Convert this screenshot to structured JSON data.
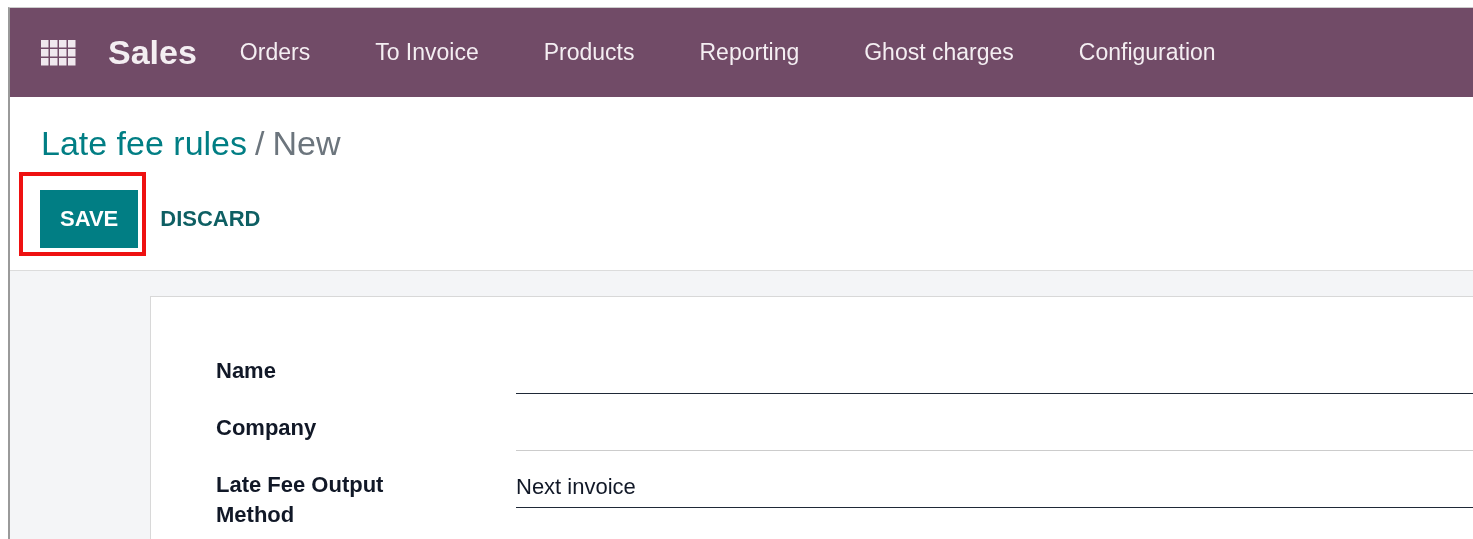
{
  "navbar": {
    "app_name": "Sales",
    "menu": [
      "Orders",
      "To Invoice",
      "Products",
      "Reporting",
      "Ghost charges",
      "Configuration"
    ]
  },
  "breadcrumb": {
    "parent": "Late fee rules",
    "separator": "/",
    "current": "New"
  },
  "buttons": [
    {
      "label": "SAVE",
      "kind": "primary",
      "highlighted": true
    },
    {
      "label": "DISCARD",
      "kind": "link",
      "highlighted": false
    }
  ],
  "form": {
    "fields": [
      {
        "label": "Name",
        "required": true
      },
      {
        "label": "Company",
        "required": false
      },
      {
        "label": "Late Fee Output Method",
        "value": "Next invoice",
        "required": true
      }
    ]
  }
}
